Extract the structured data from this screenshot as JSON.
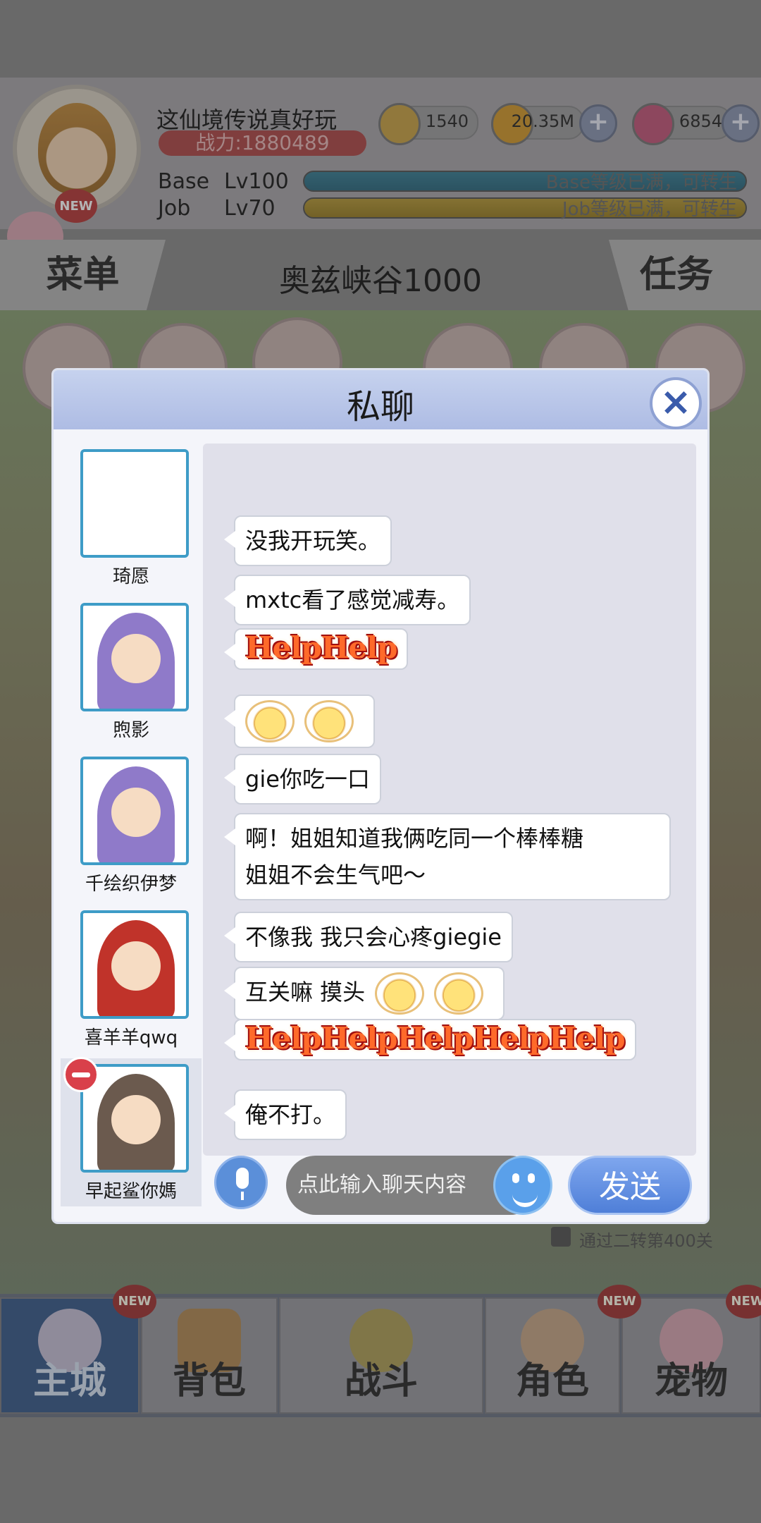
{
  "header": {
    "player_name": "这仙境传说真好玩",
    "power": "战力:1880489",
    "avatar_badge": "NEW",
    "currencies": [
      {
        "icon": "zeny-coin-icon",
        "value": "1540"
      },
      {
        "icon": "gold-coin-icon",
        "value": "20.35M"
      },
      {
        "icon": "gem-icon",
        "value": "6854"
      }
    ],
    "base_label": "Base",
    "base_level": "Lv100",
    "base_status": "Base等级已满，可转生",
    "job_label": "Job",
    "job_level": "Lv70",
    "job_status": "Job等级已满，可转生",
    "base_progress": 1.0,
    "job_progress": 1.0
  },
  "menu_bar": {
    "menu_label": "菜单",
    "map_name": "奥兹峡谷1000",
    "quest_label": "任务"
  },
  "dialog": {
    "title": "私聊",
    "close_icon": "close-icon",
    "contacts": [
      {
        "name": "琦愿",
        "portrait": "blank"
      },
      {
        "name": "煦影",
        "portrait": "purple-hair"
      },
      {
        "name": "千绘织伊梦",
        "portrait": "purple-hair"
      },
      {
        "name": "喜羊羊qwq",
        "portrait": "red-hair"
      },
      {
        "name": "早起鲨你媽",
        "portrait": "brown-hair-mask"
      }
    ],
    "messages": [
      {
        "type": "text",
        "text": "没我开玩笑。"
      },
      {
        "type": "text",
        "text": "mxtc看了感觉减寿。"
      },
      {
        "type": "sticker",
        "text": "HelpHelp"
      },
      {
        "type": "emoji",
        "count": 2
      },
      {
        "type": "text",
        "text": "gie你吃一口"
      },
      {
        "type": "text",
        "text_line1": "啊！姐姐知道我俩吃同一个棒棒糖",
        "text_line2": "姐姐不会生气吧～"
      },
      {
        "type": "text",
        "text": "不像我 我只会心疼giegie"
      },
      {
        "type": "text",
        "text": "互关嘛 摸头"
      },
      {
        "type": "sticker",
        "text": "HelpHelpHelpHelpHelp"
      },
      {
        "type": "text",
        "text": "俺不打。"
      }
    ],
    "input_placeholder": "点此输入聊天内容",
    "send_label": "发送"
  },
  "background": {
    "progress_hint": "通过二转第400关"
  },
  "bottom_nav": {
    "items": [
      {
        "label": "主城",
        "new": "NEW",
        "active": true
      },
      {
        "label": "背包",
        "new": "",
        "active": false
      },
      {
        "label": "战斗",
        "new": "",
        "active": false
      },
      {
        "label": "角色",
        "new": "NEW",
        "active": false
      },
      {
        "label": "宠物",
        "new": "NEW",
        "active": false
      }
    ]
  },
  "colors": {
    "dialog_header": "#aebce4",
    "send_button": "#4f7fd8",
    "portrait_border": "#3e9cc7",
    "remove_badge": "#d9404a"
  }
}
